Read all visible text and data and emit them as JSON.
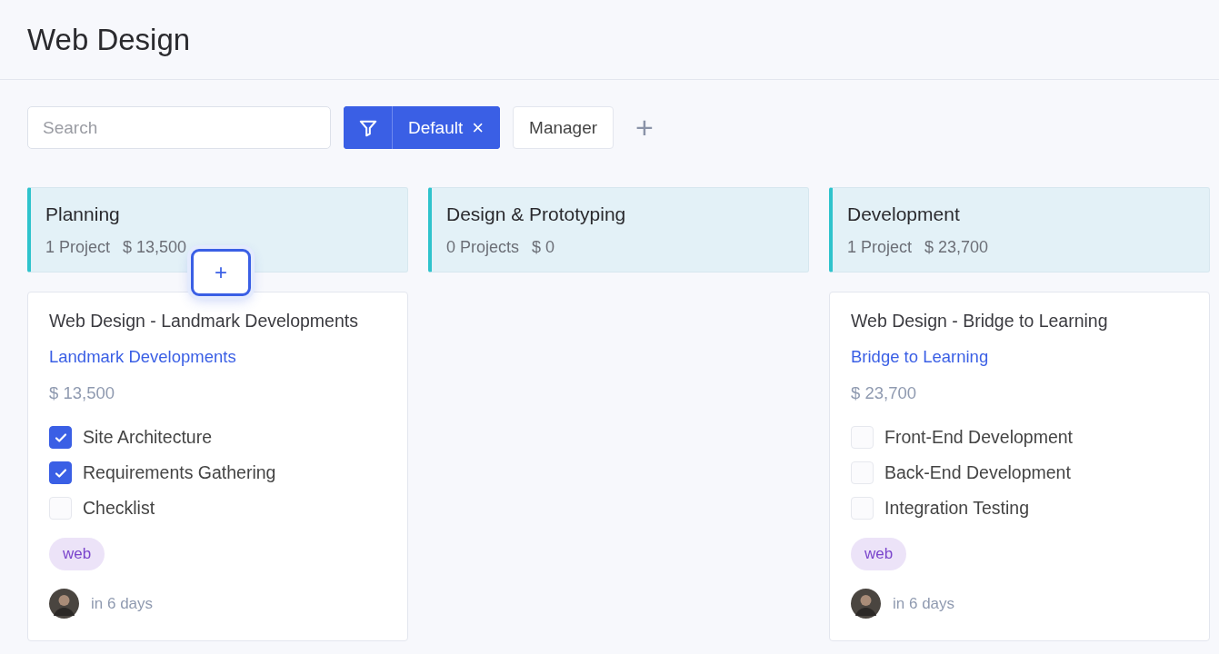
{
  "page": {
    "title": "Web Design"
  },
  "toolbar": {
    "search": {
      "placeholder": "Search"
    },
    "filter": {
      "label": "Default",
      "remove": "×"
    },
    "view_button": "Manager",
    "add_button": "+"
  },
  "columns": [
    {
      "title": "Planning",
      "count": "1 Project",
      "total": "$ 13,500",
      "add_button": "+",
      "cards": [
        {
          "title": "Web Design - Landmark Developments",
          "client": "Landmark Developments",
          "amount": "$ 13,500",
          "tasks": [
            {
              "label": "Site Architecture",
              "checked": true
            },
            {
              "label": "Requirements Gathering",
              "checked": true
            },
            {
              "label": "Checklist",
              "checked": false
            }
          ],
          "tag": "web",
          "due": "in 6 days"
        }
      ]
    },
    {
      "title": "Design & Prototyping",
      "count": "0 Projects",
      "total": "$ 0"
    },
    {
      "title": "Development",
      "count": "1 Project",
      "total": "$ 23,700",
      "cards": [
        {
          "title": "Web Design - Bridge to Learning",
          "client": "Bridge to Learning",
          "amount": "$ 23,700",
          "tasks": [
            {
              "label": "Front-End Development",
              "checked": false
            },
            {
              "label": "Back-End Development",
              "checked": false
            },
            {
              "label": "Integration Testing",
              "checked": false
            }
          ],
          "tag": "web",
          "due": "in 6 days"
        }
      ]
    }
  ]
}
